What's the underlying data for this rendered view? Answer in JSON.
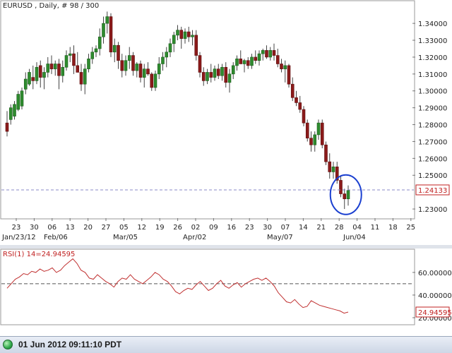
{
  "title": "EURUSD , Daily, # 98 / 300",
  "status": {
    "datetime": "01 Jun 2012 09:11:10 PDT"
  },
  "chart_data": [
    {
      "type": "candlestick",
      "symbol": "EURUSD",
      "timeframe": "Daily",
      "y_ticks": [
        "1.34000",
        "1.33000",
        "1.32000",
        "1.31000",
        "1.30000",
        "1.29000",
        "1.28000",
        "1.27000",
        "1.26000",
        "1.25000",
        "1.23000"
      ],
      "ylim": [
        1.225,
        1.348
      ],
      "current_price": 1.24133,
      "current_price_label": "1.24133",
      "x_day_ticks": [
        "23",
        "30",
        "06",
        "13",
        "20",
        "27",
        "05",
        "12",
        "19",
        "26",
        "02",
        "09",
        "16",
        "23",
        "30",
        "07",
        "14",
        "21",
        "28",
        "04",
        "11",
        "18",
        "25"
      ],
      "x_month_labels": [
        "Jan/23/12",
        "Feb/06",
        "Mar/05",
        "Apr/02",
        "May/07",
        "Jun/04"
      ],
      "candles": [
        {
          "o": 1.281,
          "h": 1.288,
          "l": 1.273,
          "c": 1.276
        },
        {
          "o": 1.283,
          "h": 1.292,
          "l": 1.28,
          "c": 1.29
        },
        {
          "o": 1.285,
          "h": 1.294,
          "l": 1.283,
          "c": 1.292
        },
        {
          "o": 1.289,
          "h": 1.3,
          "l": 1.288,
          "c": 1.298
        },
        {
          "o": 1.291,
          "h": 1.302,
          "l": 1.289,
          "c": 1.3
        },
        {
          "o": 1.301,
          "h": 1.311,
          "l": 1.298,
          "c": 1.307
        },
        {
          "o": 1.304,
          "h": 1.313,
          "l": 1.303,
          "c": 1.311
        },
        {
          "o": 1.308,
          "h": 1.315,
          "l": 1.301,
          "c": 1.306
        },
        {
          "o": 1.306,
          "h": 1.317,
          "l": 1.304,
          "c": 1.314
        },
        {
          "o": 1.315,
          "h": 1.318,
          "l": 1.302,
          "c": 1.308
        },
        {
          "o": 1.308,
          "h": 1.314,
          "l": 1.301,
          "c": 1.311
        },
        {
          "o": 1.311,
          "h": 1.32,
          "l": 1.308,
          "c": 1.316
        },
        {
          "o": 1.316,
          "h": 1.321,
          "l": 1.31,
          "c": 1.313
        },
        {
          "o": 1.313,
          "h": 1.318,
          "l": 1.309,
          "c": 1.316
        },
        {
          "o": 1.316,
          "h": 1.319,
          "l": 1.301,
          "c": 1.309
        },
        {
          "o": 1.309,
          "h": 1.318,
          "l": 1.305,
          "c": 1.314
        },
        {
          "o": 1.314,
          "h": 1.324,
          "l": 1.312,
          "c": 1.321
        },
        {
          "o": 1.321,
          "h": 1.326,
          "l": 1.317,
          "c": 1.322
        },
        {
          "o": 1.322,
          "h": 1.327,
          "l": 1.31,
          "c": 1.315
        },
        {
          "o": 1.315,
          "h": 1.323,
          "l": 1.311,
          "c": 1.311
        },
        {
          "o": 1.311,
          "h": 1.316,
          "l": 1.3,
          "c": 1.304
        },
        {
          "o": 1.304,
          "h": 1.316,
          "l": 1.298,
          "c": 1.313
        },
        {
          "o": 1.313,
          "h": 1.322,
          "l": 1.311,
          "c": 1.319
        },
        {
          "o": 1.319,
          "h": 1.326,
          "l": 1.316,
          "c": 1.323
        },
        {
          "o": 1.323,
          "h": 1.327,
          "l": 1.32,
          "c": 1.325
        },
        {
          "o": 1.325,
          "h": 1.337,
          "l": 1.321,
          "c": 1.332
        },
        {
          "o": 1.332,
          "h": 1.344,
          "l": 1.328,
          "c": 1.34
        },
        {
          "o": 1.34,
          "h": 1.347,
          "l": 1.334,
          "c": 1.344
        },
        {
          "o": 1.344,
          "h": 1.346,
          "l": 1.32,
          "c": 1.323
        },
        {
          "o": 1.323,
          "h": 1.331,
          "l": 1.317,
          "c": 1.327
        },
        {
          "o": 1.327,
          "h": 1.329,
          "l": 1.313,
          "c": 1.318
        },
        {
          "o": 1.318,
          "h": 1.322,
          "l": 1.308,
          "c": 1.312
        },
        {
          "o": 1.312,
          "h": 1.321,
          "l": 1.309,
          "c": 1.318
        },
        {
          "o": 1.318,
          "h": 1.326,
          "l": 1.313,
          "c": 1.321
        },
        {
          "o": 1.321,
          "h": 1.323,
          "l": 1.309,
          "c": 1.312
        },
        {
          "o": 1.312,
          "h": 1.317,
          "l": 1.308,
          "c": 1.316
        },
        {
          "o": 1.316,
          "h": 1.318,
          "l": 1.305,
          "c": 1.308
        },
        {
          "o": 1.308,
          "h": 1.316,
          "l": 1.302,
          "c": 1.313
        },
        {
          "o": 1.313,
          "h": 1.317,
          "l": 1.309,
          "c": 1.31
        },
        {
          "o": 1.31,
          "h": 1.311,
          "l": 1.3,
          "c": 1.302
        },
        {
          "o": 1.302,
          "h": 1.312,
          "l": 1.3,
          "c": 1.31
        },
        {
          "o": 1.31,
          "h": 1.32,
          "l": 1.307,
          "c": 1.316
        },
        {
          "o": 1.316,
          "h": 1.323,
          "l": 1.312,
          "c": 1.32
        },
        {
          "o": 1.32,
          "h": 1.326,
          "l": 1.314,
          "c": 1.323
        },
        {
          "o": 1.323,
          "h": 1.331,
          "l": 1.32,
          "c": 1.328
        },
        {
          "o": 1.328,
          "h": 1.335,
          "l": 1.323,
          "c": 1.333
        },
        {
          "o": 1.333,
          "h": 1.339,
          "l": 1.33,
          "c": 1.336
        },
        {
          "o": 1.336,
          "h": 1.338,
          "l": 1.325,
          "c": 1.331
        },
        {
          "o": 1.331,
          "h": 1.337,
          "l": 1.328,
          "c": 1.335
        },
        {
          "o": 1.335,
          "h": 1.338,
          "l": 1.329,
          "c": 1.332
        },
        {
          "o": 1.332,
          "h": 1.336,
          "l": 1.327,
          "c": 1.333
        },
        {
          "o": 1.333,
          "h": 1.336,
          "l": 1.318,
          "c": 1.321
        },
        {
          "o": 1.321,
          "h": 1.323,
          "l": 1.308,
          "c": 1.311
        },
        {
          "o": 1.311,
          "h": 1.314,
          "l": 1.303,
          "c": 1.306
        },
        {
          "o": 1.306,
          "h": 1.313,
          "l": 1.304,
          "c": 1.311
        },
        {
          "o": 1.311,
          "h": 1.316,
          "l": 1.305,
          "c": 1.308
        },
        {
          "o": 1.308,
          "h": 1.315,
          "l": 1.306,
          "c": 1.313
        },
        {
          "o": 1.313,
          "h": 1.316,
          "l": 1.307,
          "c": 1.309
        },
        {
          "o": 1.309,
          "h": 1.316,
          "l": 1.306,
          "c": 1.314
        },
        {
          "o": 1.314,
          "h": 1.317,
          "l": 1.302,
          "c": 1.305
        },
        {
          "o": 1.305,
          "h": 1.313,
          "l": 1.299,
          "c": 1.31
        },
        {
          "o": 1.31,
          "h": 1.317,
          "l": 1.307,
          "c": 1.315
        },
        {
          "o": 1.315,
          "h": 1.321,
          "l": 1.312,
          "c": 1.319
        },
        {
          "o": 1.319,
          "h": 1.324,
          "l": 1.316,
          "c": 1.316
        },
        {
          "o": 1.316,
          "h": 1.319,
          "l": 1.311,
          "c": 1.318
        },
        {
          "o": 1.318,
          "h": 1.32,
          "l": 1.313,
          "c": 1.315
        },
        {
          "o": 1.315,
          "h": 1.322,
          "l": 1.313,
          "c": 1.32
        },
        {
          "o": 1.32,
          "h": 1.324,
          "l": 1.316,
          "c": 1.318
        },
        {
          "o": 1.318,
          "h": 1.324,
          "l": 1.315,
          "c": 1.322
        },
        {
          "o": 1.322,
          "h": 1.325,
          "l": 1.318,
          "c": 1.324
        },
        {
          "o": 1.324,
          "h": 1.327,
          "l": 1.319,
          "c": 1.32
        },
        {
          "o": 1.32,
          "h": 1.326,
          "l": 1.318,
          "c": 1.324
        },
        {
          "o": 1.324,
          "h": 1.328,
          "l": 1.318,
          "c": 1.321
        },
        {
          "o": 1.321,
          "h": 1.325,
          "l": 1.314,
          "c": 1.316
        },
        {
          "o": 1.316,
          "h": 1.319,
          "l": 1.311,
          "c": 1.313
        },
        {
          "o": 1.313,
          "h": 1.318,
          "l": 1.305,
          "c": 1.315
        },
        {
          "o": 1.315,
          "h": 1.316,
          "l": 1.302,
          "c": 1.304
        },
        {
          "o": 1.304,
          "h": 1.308,
          "l": 1.294,
          "c": 1.296
        },
        {
          "o": 1.296,
          "h": 1.3,
          "l": 1.291,
          "c": 1.293
        },
        {
          "o": 1.293,
          "h": 1.297,
          "l": 1.287,
          "c": 1.289
        },
        {
          "o": 1.289,
          "h": 1.291,
          "l": 1.279,
          "c": 1.281
        },
        {
          "o": 1.281,
          "h": 1.283,
          "l": 1.27,
          "c": 1.272
        },
        {
          "o": 1.272,
          "h": 1.276,
          "l": 1.264,
          "c": 1.268
        },
        {
          "o": 1.268,
          "h": 1.276,
          "l": 1.264,
          "c": 1.274
        },
        {
          "o": 1.274,
          "h": 1.283,
          "l": 1.271,
          "c": 1.281
        },
        {
          "o": 1.281,
          "h": 1.283,
          "l": 1.266,
          "c": 1.268
        },
        {
          "o": 1.268,
          "h": 1.27,
          "l": 1.256,
          "c": 1.258
        },
        {
          "o": 1.258,
          "h": 1.263,
          "l": 1.248,
          "c": 1.252
        },
        {
          "o": 1.252,
          "h": 1.258,
          "l": 1.248,
          "c": 1.255
        },
        {
          "o": 1.255,
          "h": 1.258,
          "l": 1.245,
          "c": 1.247
        },
        {
          "o": 1.247,
          "h": 1.25,
          "l": 1.237,
          "c": 1.239
        },
        {
          "o": 1.239,
          "h": 1.242,
          "l": 1.23,
          "c": 1.236
        },
        {
          "o": 1.236,
          "h": 1.244,
          "l": 1.232,
          "c": 1.241
        }
      ]
    },
    {
      "type": "line",
      "indicator": "RSI",
      "label": "RSI(1) 14=24.94595",
      "current_label": "24.94595",
      "y_ticks": [
        "60.00000",
        "40.00000",
        "20.00000"
      ],
      "ylim": [
        15,
        78
      ],
      "reference_level": 50,
      "values": [
        46,
        50,
        54,
        56,
        59,
        58,
        61,
        60,
        63,
        61,
        62,
        64,
        60,
        62,
        66,
        69,
        72,
        68,
        62,
        60,
        55,
        54,
        58,
        55,
        52,
        50,
        47,
        52,
        55,
        54,
        58,
        54,
        52,
        50,
        53,
        56,
        60,
        58,
        54,
        52,
        48,
        43,
        41,
        44,
        46,
        45,
        49,
        52,
        48,
        44,
        46,
        50,
        53,
        48,
        46,
        49,
        51,
        47,
        50,
        52,
        54,
        55,
        53,
        55,
        52,
        48,
        42,
        38,
        34,
        33,
        36,
        32,
        29,
        30,
        35,
        33,
        31,
        30,
        29,
        28,
        27,
        26,
        24,
        25
      ]
    }
  ]
}
